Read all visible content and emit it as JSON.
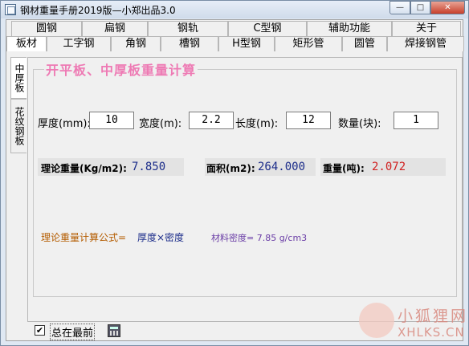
{
  "window": {
    "title": "钢材重量手册2019版—小郑出品3.0",
    "minimize_glyph": "—",
    "maximize_glyph": "□",
    "close_glyph": "✕"
  },
  "tabs_row1": [
    "圆钢",
    "扁钢",
    "钢轨",
    "C型钢",
    "辅助功能",
    "关于"
  ],
  "tabs_row2": [
    "板材",
    "工字钢",
    "角钢",
    "槽钢",
    "H型钢",
    "矩形管",
    "圆管",
    "焊接钢管"
  ],
  "side_tabs": [
    "中厚板",
    "花纹钢板"
  ],
  "section_title": "开平板、中厚板重量计算",
  "inputs": {
    "thickness": {
      "label": "厚度(mm):",
      "value": "10"
    },
    "width": {
      "label": "宽度(m):",
      "value": "2.2"
    },
    "length": {
      "label": "长度(m):",
      "value": "12"
    },
    "quantity": {
      "label": "数量(块):",
      "value": "1"
    }
  },
  "results": {
    "theory_label": "理论重量(Kg/m2):",
    "theory_value": "7.850",
    "area_label": "面积(m2):",
    "area_value": "264.000",
    "weight_label": "重量(吨):",
    "weight_value": "2.072"
  },
  "formula": {
    "label": "理论重量计算公式=",
    "expression": "厚度×密度",
    "density": "材料密度= 7.85 g/cm3"
  },
  "footer": {
    "always_on_top_label": "总在最前",
    "always_on_top_checked": "✔"
  },
  "watermark": {
    "cn": "小狐狸网",
    "en": "XHLKS.CN"
  },
  "colors": {
    "heading": "#ee7ab4",
    "value_blue": "#1c2d8a",
    "value_red": "#d12222",
    "formula_orange": "#b45c00",
    "formula_navy": "#1c2d8a",
    "formula_purple": "#6a3da6"
  }
}
